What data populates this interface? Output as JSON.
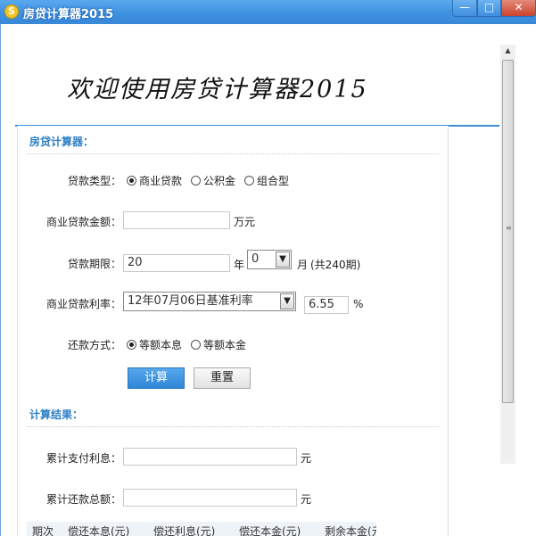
{
  "window": {
    "title": "房贷计算器2015",
    "icon_glyph": "S",
    "controls": {
      "minimize": "—",
      "maximize": "□",
      "close": "✕"
    }
  },
  "banner": {
    "text": "欢迎使用房贷计算器2015"
  },
  "calculator": {
    "section_title": "房贷计算器：",
    "loan_type": {
      "label": "贷款类型：",
      "options": [
        "商业贷款",
        "公积金",
        "组合型"
      ],
      "selected": "商业贷款"
    },
    "commercial_amount": {
      "label": "商业贷款金额：",
      "value": "",
      "unit": "万元"
    },
    "loan_term": {
      "label": "贷款期限：",
      "years_value": "20",
      "years_unit": "年",
      "months_value": "0",
      "months_unit": "月",
      "total_note": "(共240期)"
    },
    "commercial_rate": {
      "label": "商业贷款利率：",
      "rate_option": "12年07月06日基准利率",
      "rate_value": "6.55",
      "unit": "%"
    },
    "repayment_method": {
      "label": "还款方式：",
      "options": [
        "等额本息",
        "等额本金"
      ],
      "selected": "等额本息"
    },
    "buttons": {
      "calculate": "计算",
      "reset": "重置"
    }
  },
  "results": {
    "section_title": "计算结果：",
    "total_interest": {
      "label": "累计支付利息：",
      "value": "",
      "unit": "元"
    },
    "total_repayment": {
      "label": "累计还款总额：",
      "value": "",
      "unit": "元"
    },
    "table_headers": [
      "期次",
      "偿还本息(元)",
      "偿还利息(元)",
      "偿还本金(元)",
      "剩余本金(元)"
    ]
  },
  "colors": {
    "accent": "#2f7fc4",
    "titlebar": "#3c8fe0",
    "primary_button": "#3a8ee0"
  }
}
